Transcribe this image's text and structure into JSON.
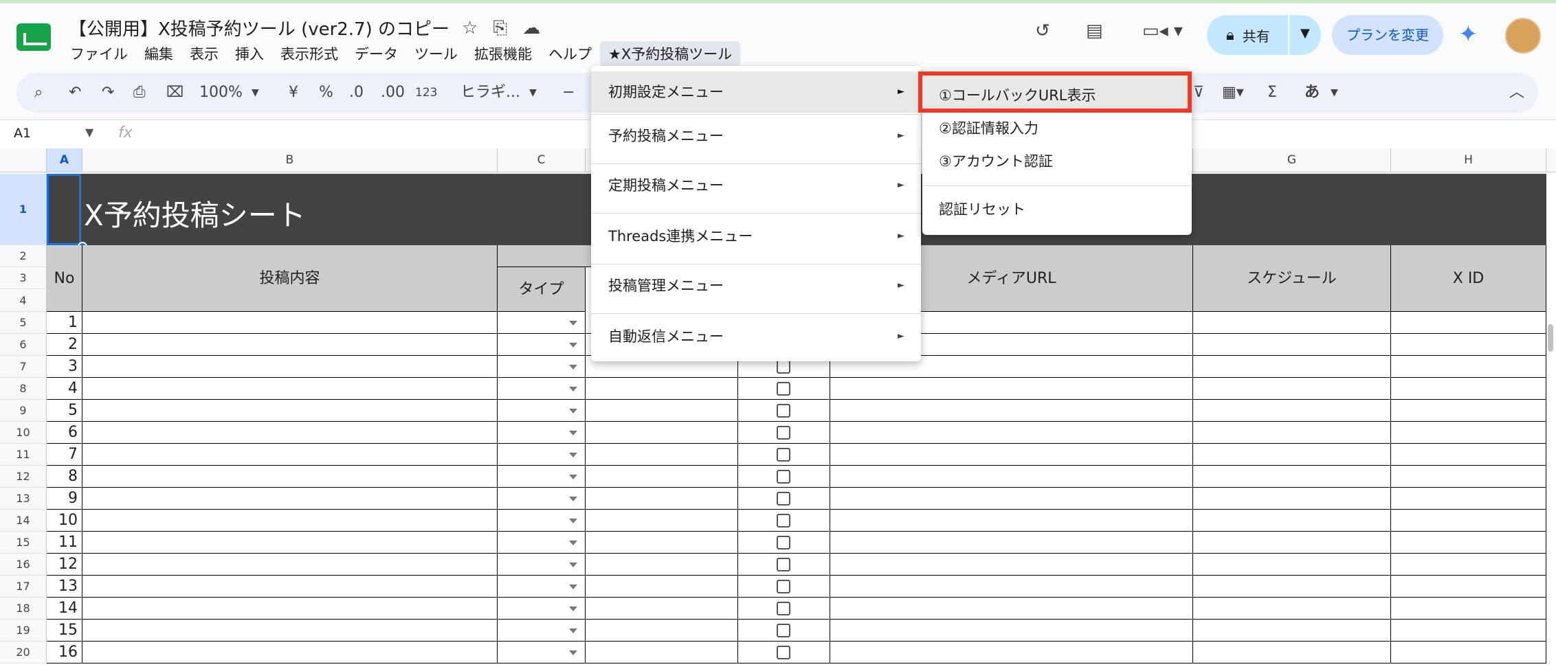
{
  "doc_title": "【公開用】X投稿予約ツール (ver2.7) のコピー",
  "menubar": [
    "ファイル",
    "編集",
    "表示",
    "挿入",
    "表示形式",
    "データ",
    "ツール",
    "拡張機能",
    "ヘルプ",
    "★X予約投稿ツール"
  ],
  "header": {
    "share_label": "共有",
    "plan_label": "プランを変更"
  },
  "toolbar": {
    "zoom": "100%",
    "currency": "¥",
    "percent": "%",
    "dec_decrease": ".0",
    "dec_increase": ".00",
    "number_format": "123",
    "font": "ヒラギ...",
    "input_tool": "あ",
    "sigma": "Σ"
  },
  "formula": {
    "cell_ref": "A1",
    "fx": "fx"
  },
  "columns": [
    "A",
    "B",
    "C",
    "G",
    "H"
  ],
  "rows": [
    "1",
    "2",
    "3",
    "4",
    "5",
    "6",
    "7",
    "8",
    "9",
    "10",
    "11",
    "12",
    "13",
    "14",
    "15",
    "16",
    "17",
    "18",
    "19",
    "20"
  ],
  "sheet": {
    "banner_title": "X予約投稿シート",
    "headers": {
      "no": "No",
      "content": "投稿内容",
      "type": "タイプ",
      "media": "メディアURL",
      "schedule": "スケジュール",
      "xid": "X ID"
    },
    "numbers": [
      "1",
      "2",
      "3",
      "4",
      "5",
      "6",
      "7",
      "8",
      "9",
      "10",
      "11",
      "12",
      "13",
      "14",
      "15",
      "16"
    ]
  },
  "menu": {
    "items": [
      "初期設定メニュー",
      "予約投稿メニュー",
      "定期投稿メニュー",
      "Threads連携メニュー",
      "投稿管理メニュー",
      "自動返信メニュー"
    ],
    "arrow": "►"
  },
  "submenu": {
    "items": [
      "①コールバックURL表示",
      "②認証情報入力",
      "③アカウント認証",
      "認証リセット"
    ]
  },
  "colors": {
    "highlight_box": "#ee3a24",
    "banner_bg": "#434343",
    "header_gray": "#cccccc",
    "share_bg": "#c2e7ff"
  }
}
